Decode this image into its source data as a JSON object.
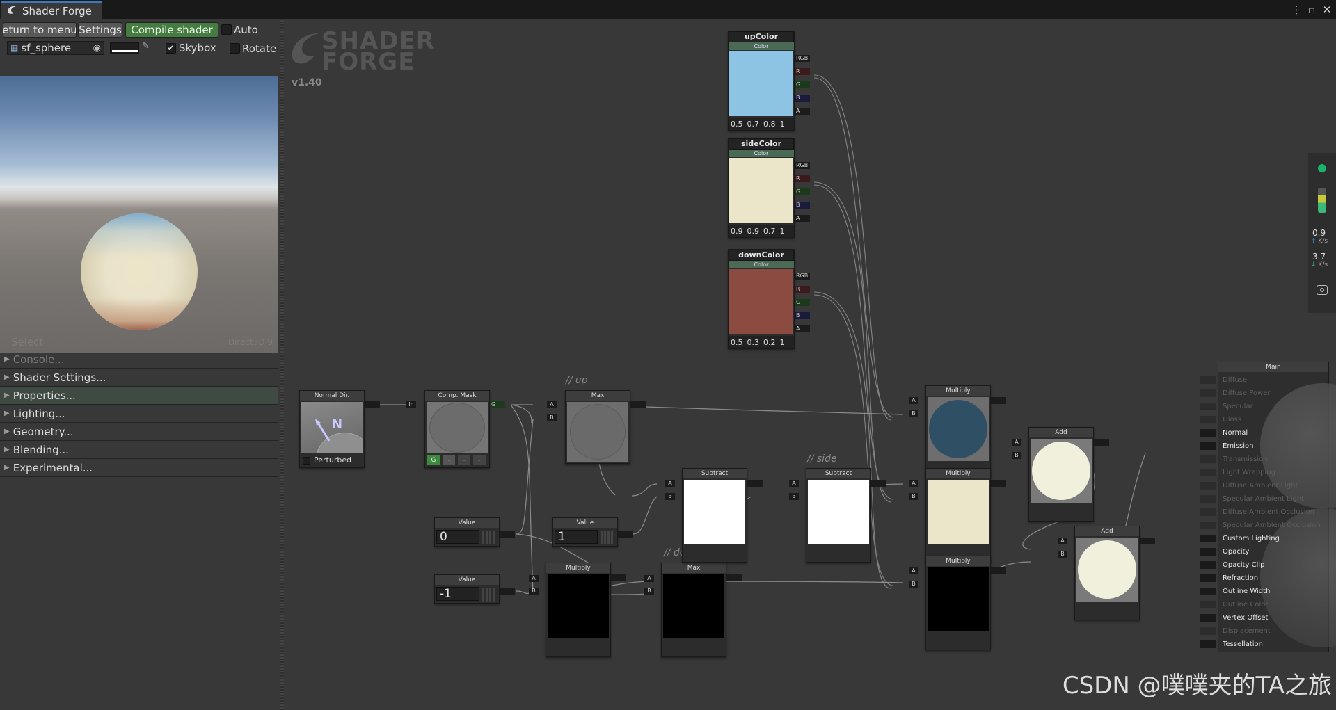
{
  "window": {
    "tab_title": "Shader Forge",
    "menu_icon": "kebab-icon",
    "max_icon": "maximize-icon",
    "close_icon": "close-icon"
  },
  "toolbar": {
    "return_label": "eturn to menu",
    "settings_label": "Settings",
    "compile_label": "Compile shader",
    "auto_label": "Auto"
  },
  "preview_bar": {
    "mesh_value": "sf_sphere",
    "skybox_label": "Skybox",
    "skybox_checked": "✔",
    "rotate_label": "Rotate"
  },
  "preview_footer": {
    "select_label": "Select",
    "renderer": "Direct3D 9"
  },
  "left_menu": {
    "console": "Console...",
    "shader_settings": "Shader Settings...",
    "properties": "Properties...",
    "lighting": "Lighting...",
    "geometry": "Geometry...",
    "blending": "Blending...",
    "experimental": "Experimental..."
  },
  "logo": {
    "line1": "SHADER",
    "line2": "FORGE",
    "version": "v1.40"
  },
  "colors": {
    "upColor": "#8dc3e3",
    "sideColor": "#ebe5c9",
    "downColor": "#8b4b41",
    "mult1": "#2f5064",
    "add": "#f1f0dc"
  },
  "nodes": {
    "upColor": {
      "title": "upColor",
      "sub": "Color",
      "values": [
        "0.5",
        "0.7",
        "0.8",
        "1"
      ]
    },
    "sideColor": {
      "title": "sideColor",
      "sub": "Color",
      "values": [
        "0.9",
        "0.9",
        "0.7",
        "1"
      ]
    },
    "downColor": {
      "title": "downColor",
      "sub": "Color",
      "values": [
        "0.5",
        "0.3",
        "0.2",
        "1"
      ]
    },
    "normal_dir": {
      "title": "Normal Dir.",
      "letter": "N",
      "perturbed": "Perturbed"
    },
    "comp_mask": {
      "title": "Comp. Mask",
      "channels": [
        "G",
        "-",
        "-",
        "-"
      ]
    },
    "max_up": {
      "title": "Max"
    },
    "max_down": {
      "title": "Max"
    },
    "value0": {
      "title": "Value",
      "value": "0"
    },
    "value1": {
      "title": "Value",
      "value": "1"
    },
    "value_neg1": {
      "title": "Value",
      "value": "-1"
    },
    "multiply_down": {
      "title": "Multiply"
    },
    "subtract1": {
      "title": "Subtract"
    },
    "subtract2": {
      "title": "Subtract"
    },
    "multiply1": {
      "title": "Multiply"
    },
    "multiply2": {
      "title": "Multiply"
    },
    "multiply3": {
      "title": "Multiply"
    },
    "add1": {
      "title": "Add"
    },
    "add2": {
      "title": "Add"
    }
  },
  "ports": {
    "rgb": "RGB",
    "r": "R",
    "g": "G",
    "b": "B",
    "a": "A",
    "in": "In",
    "pa": "A",
    "pb": "B"
  },
  "comments": {
    "up": "// up",
    "side": "// side",
    "down": "// down"
  },
  "main_node": {
    "title": "Main",
    "rows": [
      {
        "label": "Diffuse",
        "active": false
      },
      {
        "label": "Diffuse Power",
        "active": false
      },
      {
        "label": "Specular",
        "active": false
      },
      {
        "label": "Gloss",
        "active": false
      },
      {
        "label": "Normal",
        "active": true
      },
      {
        "label": "Emission",
        "active": true
      },
      {
        "label": "Transmission",
        "active": false
      },
      {
        "label": "Light Wrapping",
        "active": false
      },
      {
        "label": "Diffuse Ambient Light",
        "active": false
      },
      {
        "label": "Specular Ambient Light",
        "active": false
      },
      {
        "label": "Diffuse Ambient Occlusion",
        "active": false
      },
      {
        "label": "Specular Ambient Occlusion",
        "active": false
      },
      {
        "label": "Custom Lighting",
        "active": true
      },
      {
        "label": "Opacity",
        "active": true
      },
      {
        "label": "Opacity Clip",
        "active": true
      },
      {
        "label": "Refraction",
        "active": true
      },
      {
        "label": "Outline Width",
        "active": true
      },
      {
        "label": "Outline Color",
        "active": false
      },
      {
        "label": "Vertex Offset",
        "active": true
      },
      {
        "label": "Displacement",
        "active": false
      },
      {
        "label": "Tessellation",
        "active": true
      }
    ]
  },
  "net_widget": {
    "up_value": "0.9",
    "up_unit": "K/s",
    "down_value": "3.7",
    "down_unit": "K/s"
  },
  "watermark": "CSDN @噗噗夹的TA之旅"
}
